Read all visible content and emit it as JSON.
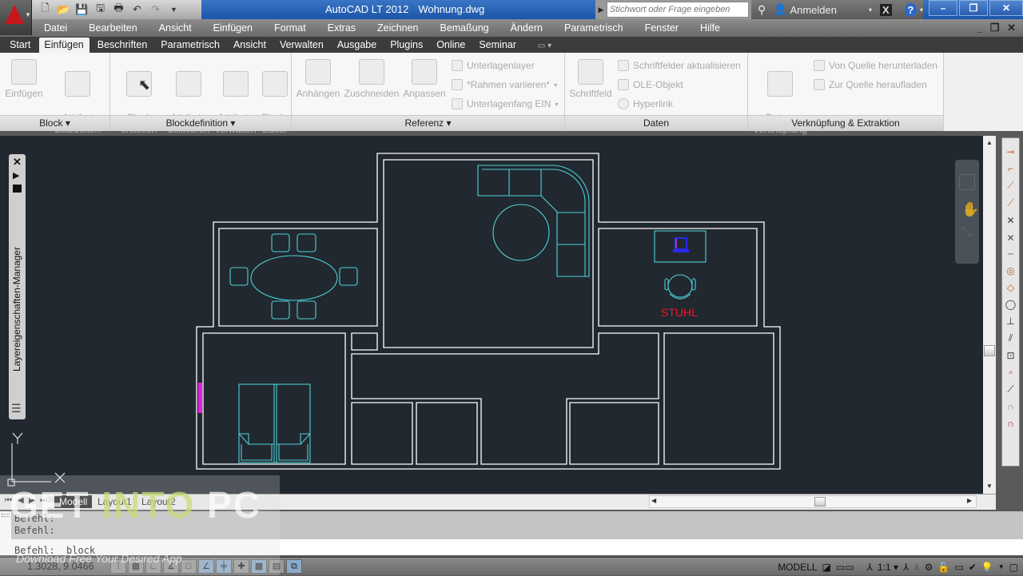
{
  "titlebar": {
    "app_name": "AutoCAD LT 2012",
    "document": "Wohnung.dwg",
    "search_placeholder": "Stichwort oder Frage eingeben",
    "signin": "Anmelden",
    "window_controls": {
      "minimize": "–",
      "restore": "❐",
      "close": "✕"
    }
  },
  "quick_access": [
    "new-icon",
    "open-icon",
    "save-icon",
    "save-as-icon",
    "plot-icon",
    "undo-icon",
    "redo-icon",
    "customize-icon"
  ],
  "menubar": {
    "items": [
      "Datei",
      "Bearbeiten",
      "Ansicht",
      "Einfügen",
      "Format",
      "Extras",
      "Zeichnen",
      "Bemaßung",
      "Ändern",
      "Parametrisch",
      "Fenster",
      "Hilfe"
    ],
    "doc_controls": "_ ❐ ✕"
  },
  "ribbon_tabs": {
    "items": [
      "Start",
      "Einfügen",
      "Beschriften",
      "Parametrisch",
      "Ansicht",
      "Verwalten",
      "Ausgabe",
      "Plugins",
      "Online",
      "Seminar"
    ],
    "active": "Einfügen",
    "extra": "▭ ▾"
  },
  "ribbon": {
    "panels": [
      {
        "title": "Block ▾",
        "buttons": [
          "Einfügen",
          "Attribut\nbearbeiten"
        ]
      },
      {
        "title": "Blockdefinition ▾",
        "buttons": [
          "Block\nerstellen",
          "Attribute\ndefinieren",
          "Attribute\nverwalten",
          "Block-\nEditor"
        ]
      },
      {
        "title": "Referenz ▾",
        "buttons": [
          "Anhängen",
          "Zuschneiden",
          "Anpassen"
        ],
        "small": [
          "Unterlagenlayer",
          "*Rahmen variieren*",
          "Unterlagenfang EIN"
        ]
      },
      {
        "title": "Daten",
        "buttons": [
          "Schriftfeld"
        ],
        "small": [
          "Schriftfelder aktualisieren",
          "OLE-Objekt",
          "Hyperlink"
        ]
      },
      {
        "title": "Verknüpfung & Extraktion",
        "buttons": [
          "Daten-\nVerknüpfung"
        ],
        "small": [
          "Von Quelle herunterladen",
          "Zur Quelle heraufladen"
        ]
      }
    ]
  },
  "layer_palette": {
    "title": "Layereigenschaften-Manager"
  },
  "drawing": {
    "label": "STUHL",
    "colors": {
      "walls": "#ffffff",
      "furniture": "#4fd1d6",
      "label": "#e0202a",
      "monitor": "#2a2aee",
      "window": "#e020e0",
      "background": "#212830"
    },
    "ucs_y": "Y"
  },
  "layout_tabs": [
    "Modell",
    "Layout1",
    "Layout2"
  ],
  "command_line": {
    "history": [
      "Befehl:",
      "Befehl:"
    ],
    "current": "Befehl:  _block"
  },
  "statusbar": {
    "coords": "1.3028, 9.0466",
    "space": "MODELL",
    "scale": "1:1 ▾"
  },
  "watermark": {
    "main_a": "GET ",
    "main_b": "INTO",
    "main_c": " PC",
    "sub": "Download Free Your Desired App"
  }
}
